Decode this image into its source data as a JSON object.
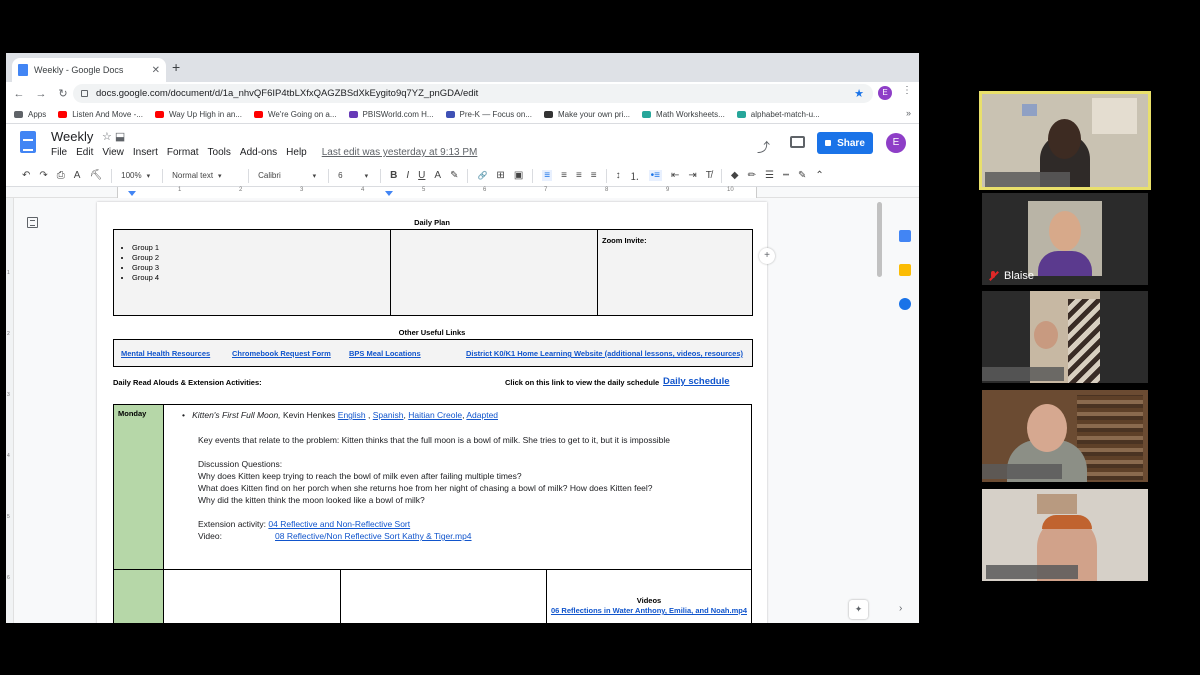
{
  "browser": {
    "tab_title": "Weekly - Google Docs",
    "tab_close": "✕",
    "new_tab": "+",
    "url": "docs.google.com/document/d/1a_nhvQF6IP4tbLXfxQAGZBSdXkEygito9q7YZ_pnGDA/edit",
    "profile_initial": "E",
    "back": "←",
    "forward": "→",
    "reload": "↻",
    "star": "★",
    "menu": "⋮",
    "more": "»",
    "bookmarks": [
      {
        "label": "Apps",
        "color": "#5f6368"
      },
      {
        "label": "Listen And Move -...",
        "color": "#ff0000"
      },
      {
        "label": "Way Up High in an...",
        "color": "#ff0000"
      },
      {
        "label": "We're Going on a...",
        "color": "#ff0000"
      },
      {
        "label": "PBISWorld.com H...",
        "color": "#673ab7"
      },
      {
        "label": "Pre-K — Focus on...",
        "color": "#3f51b5"
      },
      {
        "label": "Make your own pri...",
        "color": "#333333"
      },
      {
        "label": "Math Worksheets...",
        "color": "#26a69a"
      },
      {
        "label": "alphabet-match-u...",
        "color": "#26a69a"
      }
    ]
  },
  "docs": {
    "title": "Weekly",
    "title_icons": "☆  ⬓",
    "menu": [
      "File",
      "Edit",
      "View",
      "Insert",
      "Format",
      "Tools",
      "Add-ons",
      "Help"
    ],
    "last_edit": "Last edit was yesterday at 9:13 PM",
    "share": "Share",
    "avatar": "E",
    "trend_icon": "⤴",
    "toolbar": {
      "undo": "↶",
      "redo": "↷",
      "print": "⎙",
      "spell": "A",
      "paint": "⛏",
      "zoom": "100%",
      "style": "Normal text",
      "font": "Calibri",
      "size": "6",
      "bold": "B",
      "italic": "I",
      "underline": "U",
      "color": "A",
      "highlight": "✎",
      "link": "🔗",
      "comment": "⊞",
      "image": "▣",
      "align_left": "≡",
      "align_center": "≡",
      "align_right": "≡",
      "justify": "≡",
      "line_spacing": "↕",
      "numbered": "⒈",
      "bulleted": "•≡",
      "indent_dec": "⇤",
      "indent_inc": "⇥",
      "clear": "T̸",
      "fill": "◆",
      "border_color": "✏",
      "border_width": "☰",
      "border_dash": "┅",
      "edit_mode": "✎",
      "collapse": "⌃",
      "caret": "▾"
    },
    "ruler_numbers": [
      "1",
      "2",
      "3",
      "4",
      "5",
      "6",
      "7",
      "8",
      "9",
      "10"
    ],
    "vruler_numbers": [
      "1",
      "2",
      "3",
      "4",
      "5",
      "6"
    ],
    "add_comment": "+",
    "explore": "✦",
    "side_chevron": "›"
  },
  "doc": {
    "daily_plan_heading": "Daily Plan",
    "groups": [
      "Group 1",
      "Group 2",
      "Group 3",
      "Group 4"
    ],
    "zoom_invite": "Zoom Invite:",
    "other_links_heading": "Other Useful Links",
    "links": [
      "Mental Health Resources",
      "Chromebook Request Form",
      "BPS Meal Locations",
      "District K0/K1 Home Learning Website (additional lessons, videos, resources)"
    ],
    "read_alouds_label": "Daily Read Alouds & Extension Activities:",
    "schedule_prompt": "Click on this link to view the daily schedule",
    "schedule_link": "Daily schedule",
    "monday_label": "Monday",
    "book_title": "Kitten's First Full Moon,",
    "book_author": " Kevin Henkes ",
    "book_links": [
      "English",
      "Spanish",
      "Haitian Creole",
      "Adapted"
    ],
    "key_events": "Key events that relate to the problem: Kitten thinks that the full moon is a bowl of milk. She tries to get to it, but it is impossible",
    "discussion_heading": "Discussion Questions:",
    "questions": [
      "Why does Kitten keep trying to reach the bowl of milk even after failing multiple times?",
      "What does Kitten find on her porch when she returns hoe from her night of chasing a bowl of milk? How does Kitten feel?",
      "Why did the kitten think the moon looked like a bowl of milk?"
    ],
    "extension_label": "Extension activity: ",
    "extension_link": "04 Reflective and Non-Reflective Sort",
    "video_label": "Video:",
    "video_link": "08 Reflective/Non Reflective Sort Kathy & Tiger.mp4",
    "videos_heading": "Videos",
    "videos_link": "06 Reflections in Water Anthony, Emilia, and Noah.mp4"
  },
  "zoom": {
    "participants": [
      {
        "name": "",
        "active": true
      },
      {
        "name": "Blaise",
        "muted": true
      },
      {
        "name": ""
      },
      {
        "name": ""
      },
      {
        "name": ""
      }
    ]
  }
}
